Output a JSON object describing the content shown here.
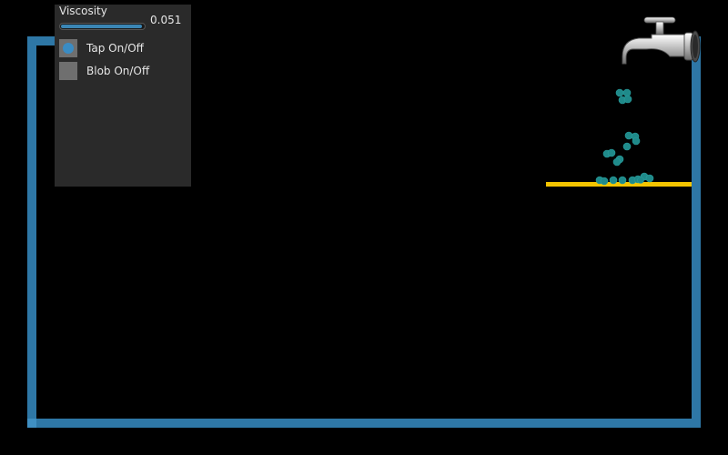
{
  "controls": {
    "viscosity_label": "Viscosity",
    "viscosity_value": "0.051",
    "viscosity_fraction": 0.98,
    "tap_label": "Tap On/Off",
    "tap_on": true,
    "blob_label": "Blob On/Off",
    "blob_on": false
  },
  "colors": {
    "background": "#000000",
    "container": "#2e77a6",
    "shelf": "#f4c500",
    "fluid": "#1f8a8a",
    "panel": "#2a2a2a"
  },
  "icons": {
    "faucet": "faucet-icon"
  }
}
